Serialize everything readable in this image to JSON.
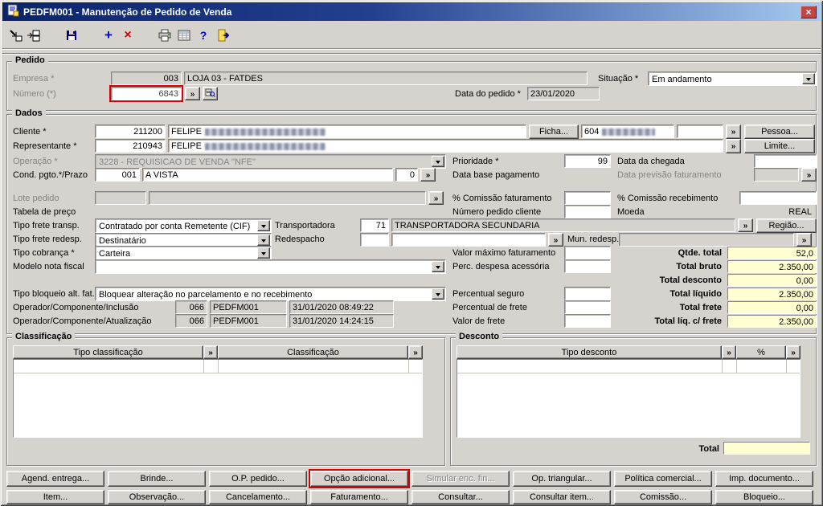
{
  "window": {
    "title": "PEDFM001 - Manutenção de Pedido de Venda",
    "close": "×"
  },
  "ui": {
    "more": "»"
  },
  "annotations": {
    "highlight_color": "#dc0000",
    "highlighted": [
      "numero-field",
      "opcao-adicional-button"
    ]
  },
  "pedido": {
    "legend": "Pedido",
    "empresa_label": "Empresa *",
    "empresa_code": "003",
    "empresa_name": "LOJA 03 - FATDES",
    "situacao_label": "Situação *",
    "situacao_value": "Em andamento",
    "numero_label": "Número (*)",
    "numero_value": "6843",
    "data_pedido_label": "Data do pedido *",
    "data_pedido_value": "23/01/2020"
  },
  "dados": {
    "legend": "Dados",
    "cliente_label": "Cliente *",
    "cliente_code": "211200",
    "cliente_name": "FELIPE",
    "ficha_button": "Ficha...",
    "cliente_doc": "604",
    "pessoa_button": "Pessoa...",
    "representante_label": "Representante *",
    "representante_code": "210943",
    "representante_name": "FELIPE",
    "limite_button": "Limite...",
    "operacao_label": "Operação *",
    "operacao_value": "3228 - REQUISICAO DE VENDA \"NFE\"",
    "prioridade_label": "Prioridade *",
    "prioridade_value": "99",
    "data_chegada_label": "Data da chegada",
    "cond_pgto_label": "Cond. pgto.*/Prazo",
    "cond_pgto_code": "001",
    "cond_pgto_desc": "A VISTA",
    "cond_pgto_prazo": "0",
    "data_base_label": "Data base pagamento",
    "data_previsao_label": "Data previsão faturamento",
    "lote_label": "Lote pedido",
    "tabela_preco_label": "Tabela de preço",
    "comissao_fat_label": "% Comissão faturamento",
    "comissao_rec_label": "% Comissão recebimento",
    "num_pedido_cliente_label": "Número pedido cliente",
    "moeda_label": "Moeda",
    "moeda_value": "REAL",
    "tipo_frete_transp_label": "Tipo frete transp.",
    "tipo_frete_transp_value": "Contratado por conta Remetente (CIF)",
    "transportadora_label": "Transportadora",
    "transportadora_code": "71",
    "transportadora_name": "TRANSPORTADORA SECUNDARIA",
    "regiao_button": "Região...",
    "tipo_frete_redesp_label": "Tipo frete redesp.",
    "tipo_frete_redesp_value": "Destinatário",
    "redespacho_label": "Redespacho",
    "mun_redesp_label": "Mun. redesp.",
    "tipo_cobranca_label": "Tipo cobrança *",
    "tipo_cobranca_value": "Carteira",
    "valor_max_fat_label": "Valor máximo faturamento",
    "modelo_nf_label": "Modelo nota fiscal",
    "perc_despesa_label": "Perc. despesa acessória",
    "tipo_bloqueio_label": "Tipo bloqueio alt. fat.",
    "tipo_bloqueio_value": "Bloquear alteração no parcelamento e no recebimento",
    "percentual_seguro_label": "Percentual seguro",
    "percentual_frete_label": "Percentual de frete",
    "valor_frete_label": "Valor de frete",
    "op_inclusao_label": "Operador/Componente/Inclusão",
    "op_inclusao_code": "066",
    "op_inclusao_comp": "PEDFM001",
    "op_inclusao_data": "31/01/2020 08:49:22",
    "op_atualizacao_label": "Operador/Componente/Atualização",
    "op_atualizacao_code": "066",
    "op_atualizacao_comp": "PEDFM001",
    "op_atualizacao_data": "31/01/2020 14:24:15",
    "totais": {
      "qtde_label": "Qtde. total",
      "qtde_value": "52,0",
      "bruto_label": "Total bruto",
      "bruto_value": "2.350,00",
      "desconto_label": "Total desconto",
      "desconto_value": "0,00",
      "liquido_label": "Total líquido",
      "liquido_value": "2.350,00",
      "frete_label": "Total frete",
      "frete_value": "0,00",
      "liq_frete_label": "Total líq. c/ frete",
      "liq_frete_value": "2.350,00"
    }
  },
  "classificacao": {
    "legend": "Classificação",
    "col1": "Tipo classificação",
    "col2": "Classificação"
  },
  "desconto": {
    "legend": "Desconto",
    "col1": "Tipo desconto",
    "col2": "%",
    "total_label": "Total"
  },
  "buttons_row1": [
    "Agend. entrega...",
    "Brinde...",
    "O.P. pedido...",
    "Opção adicional...",
    "Simular enc. fin...",
    "Op. triangular...",
    "Política comercial...",
    "Imp. documento..."
  ],
  "buttons_row2": [
    "Item...",
    "Observação...",
    "Cancelamento...",
    "Faturamento...",
    "Consultar...",
    "Consultar item...",
    "Comissão...",
    "Bloqueio..."
  ]
}
